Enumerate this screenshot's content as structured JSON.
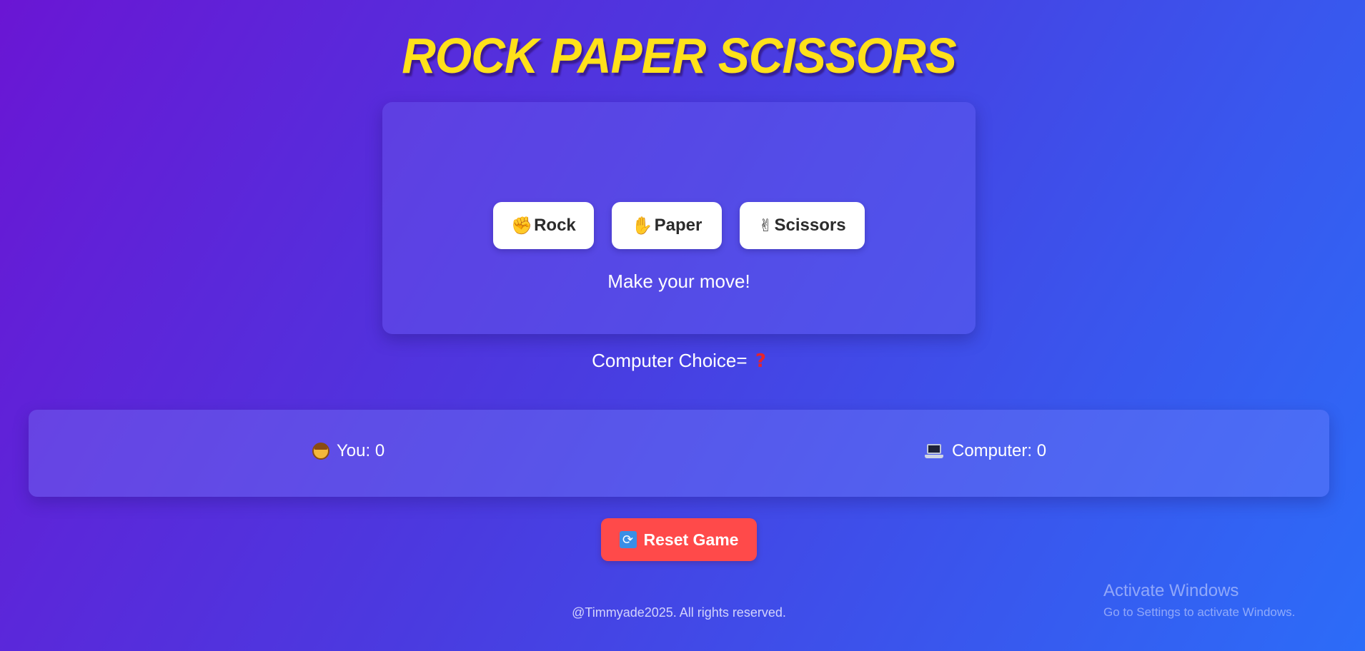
{
  "title": "ROCK PAPER SCISSORS",
  "choices": [
    {
      "emoji": "✊",
      "label": "Rock"
    },
    {
      "emoji": "✋",
      "label": "Paper"
    },
    {
      "emoji": "✌",
      "label": "Scissors"
    }
  ],
  "status_message": "Make your move!",
  "computer_choice": {
    "label": "Computer Choice=",
    "value": "?"
  },
  "scoreboard": {
    "you_label": "You: 0",
    "computer_label": "Computer: 0"
  },
  "reset_button": {
    "icon": "⟳",
    "label": "Reset Game"
  },
  "footer": "@Timmyade2025. All rights reserved.",
  "watermark": {
    "title": "Activate Windows",
    "subtitle": "Go to Settings to activate Windows."
  },
  "colors": {
    "title": "#ffe11a",
    "reset_button": "#ff4a4a",
    "background_start": "#6a16d4",
    "background_end": "#2c6cf8"
  }
}
